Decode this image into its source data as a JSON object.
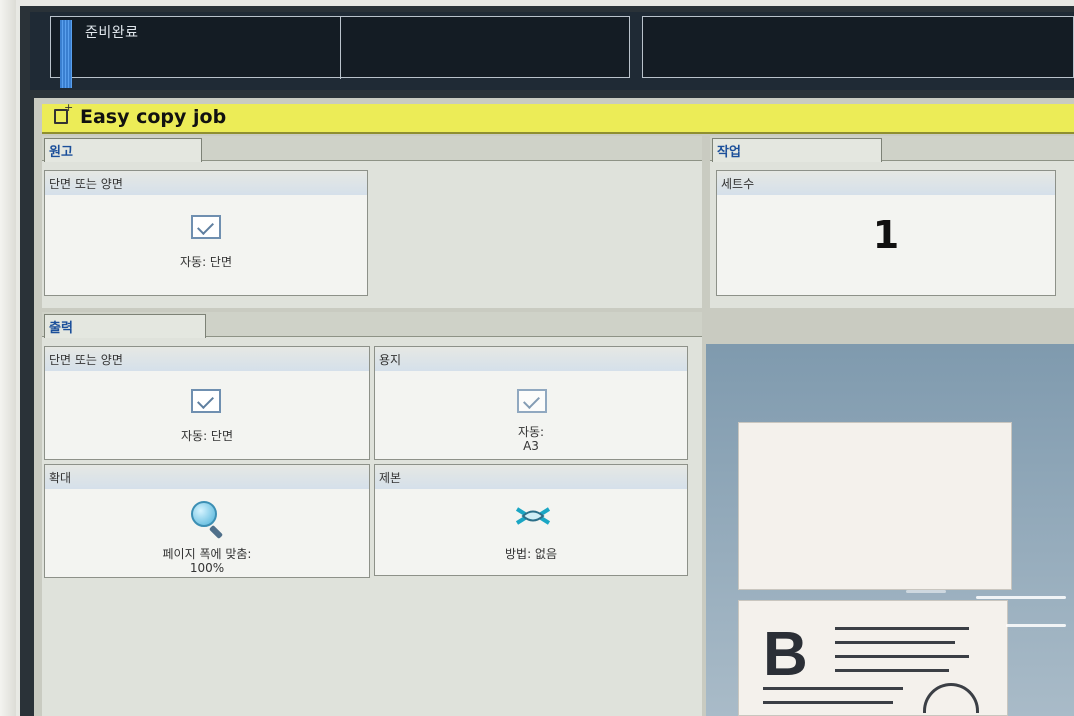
{
  "status": {
    "state_text": "준비완료"
  },
  "job": {
    "title": "Easy copy job"
  },
  "original": {
    "tab_label": "원고",
    "duplex": {
      "label": "단면 또는 양면",
      "value": "자동: 단면"
    }
  },
  "work": {
    "tab_label": "작업",
    "sets": {
      "label": "세트수",
      "value": "1"
    }
  },
  "output": {
    "tab_label": "출력",
    "duplex": {
      "label": "단면 또는 양면",
      "value": "자동: 단면"
    },
    "paper": {
      "label": "용지",
      "value_line1": "자동:",
      "value_line2": "A3"
    },
    "zoom": {
      "label": "확대",
      "value_line1": "페이지 폭에 맞춤:",
      "value_line2": "100%"
    },
    "binding": {
      "label": "제본",
      "value": "방법: 없음"
    }
  },
  "preview": {
    "letter": "B"
  },
  "icons": {
    "job": "new-document-icon",
    "check": "checkbox-checked-icon",
    "zoom": "magnifier-icon",
    "binding": "binding-icon"
  },
  "colors": {
    "title_bar": "#ecec57",
    "tab_text": "#1b4f9a",
    "status_bg": "#141c24"
  }
}
